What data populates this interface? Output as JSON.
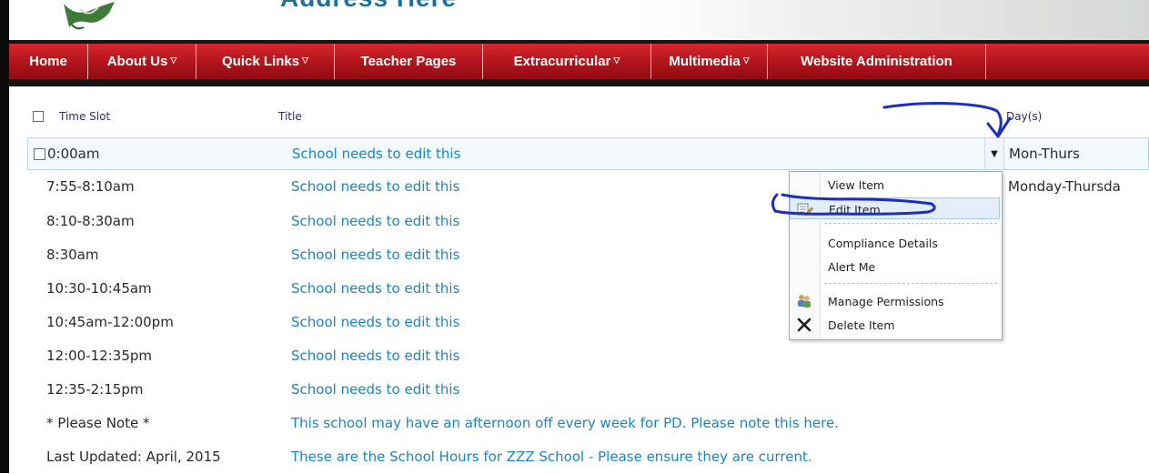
{
  "banner": {
    "partial_text": "Address Here"
  },
  "nav": {
    "items": [
      {
        "label": "Home",
        "has_menu": false
      },
      {
        "label": "About Us",
        "has_menu": true
      },
      {
        "label": "Quick Links",
        "has_menu": true
      },
      {
        "label": "Teacher Pages",
        "has_menu": false
      },
      {
        "label": "Extracurricular",
        "has_menu": true
      },
      {
        "label": "Multimedia",
        "has_menu": true
      },
      {
        "label": "Website Administration",
        "has_menu": false
      }
    ],
    "caret_glyph": "▽"
  },
  "list": {
    "columns": {
      "time_slot": "Time Slot",
      "title": "Title",
      "days": "Day(s)"
    },
    "rows": [
      {
        "time": "0:00am",
        "title": "School needs to edit this",
        "days": "Mon-Thurs"
      },
      {
        "time": "7:55-8:10am",
        "title": "School needs to edit this",
        "days": "Monday-Thursda"
      },
      {
        "time": "8:10-8:30am",
        "title": "School needs to edit this",
        "days": ""
      },
      {
        "time": "8:30am",
        "title": "School needs to edit this",
        "days": ""
      },
      {
        "time": "10:30-10:45am",
        "title": "School needs to edit this",
        "days": ""
      },
      {
        "time": "10:45am-12:00pm",
        "title": "School needs to edit this",
        "days": ""
      },
      {
        "time": "12:00-12:35pm",
        "title": "School needs to edit this",
        "days": ""
      },
      {
        "time": "12:35-2:15pm",
        "title": "School needs to edit this",
        "days": ""
      },
      {
        "time": "* Please Note *",
        "title": "This school may have an afternoon off every week for PD. Please note this here.",
        "days": ""
      },
      {
        "time": "Last Updated: April, 2015",
        "title": "These are the School Hours for ZZZ School - Please ensure they are current.",
        "days": ""
      }
    ],
    "dropdown_glyph": "▼"
  },
  "context_menu": {
    "items": [
      {
        "label": "View Item",
        "icon": ""
      },
      {
        "label": "Edit Item",
        "icon": "edit-item-icon"
      },
      {
        "label": "Compliance Details",
        "icon": ""
      },
      {
        "label": "Alert Me",
        "icon": ""
      },
      {
        "label": "Manage Permissions",
        "icon": "manage-permissions-icon"
      },
      {
        "label": "Delete Item",
        "icon": "delete-icon"
      }
    ],
    "highlighted": "Edit Item"
  },
  "colors": {
    "nav_red": "#c0181f",
    "link_blue": "#1b84c4",
    "header_text": "#2b2b6b",
    "annotation_blue": "#1a2fbf"
  }
}
